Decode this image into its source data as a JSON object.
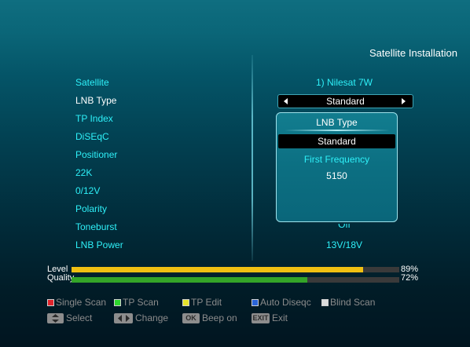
{
  "header": {
    "title": "Satellite Installation"
  },
  "settings": {
    "rows": [
      {
        "label": "Satellite",
        "value": "1) Nilesat 7W"
      },
      {
        "label": "LNB Type",
        "value": "Standard"
      },
      {
        "label": "TP Index",
        "value": ""
      },
      {
        "label": "DiSEqC",
        "value": ""
      },
      {
        "label": "Positioner",
        "value": ""
      },
      {
        "label": "22K",
        "value": ""
      },
      {
        "label": "0/12V",
        "value": ""
      },
      {
        "label": "Polarity",
        "value": ""
      },
      {
        "label": "Toneburst",
        "value": "Off"
      },
      {
        "label": "LNB Power",
        "value": "13V/18V"
      }
    ]
  },
  "popup": {
    "title": "LNB Type",
    "selected": "Standard",
    "field_label": "First Frequency",
    "field_value": "5150"
  },
  "signal": {
    "level": {
      "label": "Level",
      "percent": 89,
      "percent_text": "89%"
    },
    "quality": {
      "label": "Quality",
      "percent": 72,
      "percent_text": "72%"
    }
  },
  "hints": {
    "color_keys": [
      {
        "color": "#e0242c",
        "label": "Single Scan"
      },
      {
        "color": "#2ed62e",
        "label": "TP Scan"
      },
      {
        "color": "#e6e22a",
        "label": "TP Edit"
      },
      {
        "color": "#2a64d8",
        "label": "Auto Diseqc"
      },
      {
        "color": "#dcdcdc",
        "label": "Blind Scan"
      }
    ],
    "nav_keys": [
      {
        "key": "",
        "icon": "up-down-arrows-icon",
        "label": "Select"
      },
      {
        "key": "",
        "icon": "left-right-arrows-icon",
        "label": "Change"
      },
      {
        "key": "OK",
        "icon": "",
        "label": "Beep on"
      },
      {
        "key": "EXIT",
        "icon": "",
        "label": "Exit"
      }
    ]
  }
}
